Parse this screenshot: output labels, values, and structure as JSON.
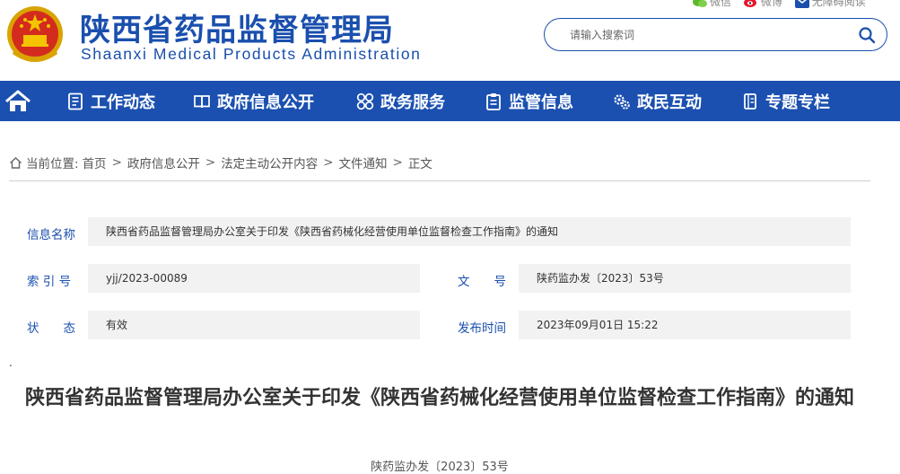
{
  "header": {
    "title": "陕西省药品监督管理局",
    "subtitle": "Shaanxi Medical Products Administration",
    "emblem_icon": "national-emblem-icon",
    "top_links": [
      {
        "label": "微信",
        "icon": "wechat-icon"
      },
      {
        "label": "微博",
        "icon": "weibo-icon"
      },
      {
        "label": "无障碍阅读",
        "icon": "accessibility-icon"
      }
    ],
    "search": {
      "placeholder": "请输入搜索词",
      "value": ""
    }
  },
  "nav": {
    "home_icon": "home-icon",
    "items": [
      {
        "label": "工作动态",
        "icon": "document-list-icon"
      },
      {
        "label": "政府信息公开",
        "icon": "open-book-icon"
      },
      {
        "label": "政务服务",
        "icon": "grid-circles-icon"
      },
      {
        "label": "监管信息",
        "icon": "clipboard-icon"
      },
      {
        "label": "政民互动",
        "icon": "gears-icon"
      },
      {
        "label": "专题专栏",
        "icon": "notebook-icon"
      }
    ]
  },
  "breadcrumb": {
    "prefix": "当前位置:",
    "items": [
      "首页",
      "政府信息公开",
      "法定主动公开内容",
      "文件通知",
      "正文"
    ],
    "separator": ">"
  },
  "info": {
    "name_label": "信息名称",
    "name_value": "陕西省药品监督管理局办公室关于印发《陕西省药械化经营使用单位监督检查工作指南》的通知",
    "index_label": "索 引 号",
    "index_value": "yjj/2023-00089",
    "doc_no_label": "文　　号",
    "doc_no_value": "陕药监办发〔2023〕53号",
    "status_label": "状　　态",
    "status_value": "有效",
    "date_label": "发布时间",
    "date_value": "2023年09月01日 15:22"
  },
  "article": {
    "dot": ".",
    "title": "陕西省药品监督管理局办公室关于印发《陕西省药械化经营使用单位监督检查工作指南》的通知",
    "doc_number": "陕药监办发〔2023〕53号"
  },
  "colors": {
    "brand": "#1b50b0",
    "title_blue": "#1a4fae",
    "panel": "#f2f2f2"
  }
}
